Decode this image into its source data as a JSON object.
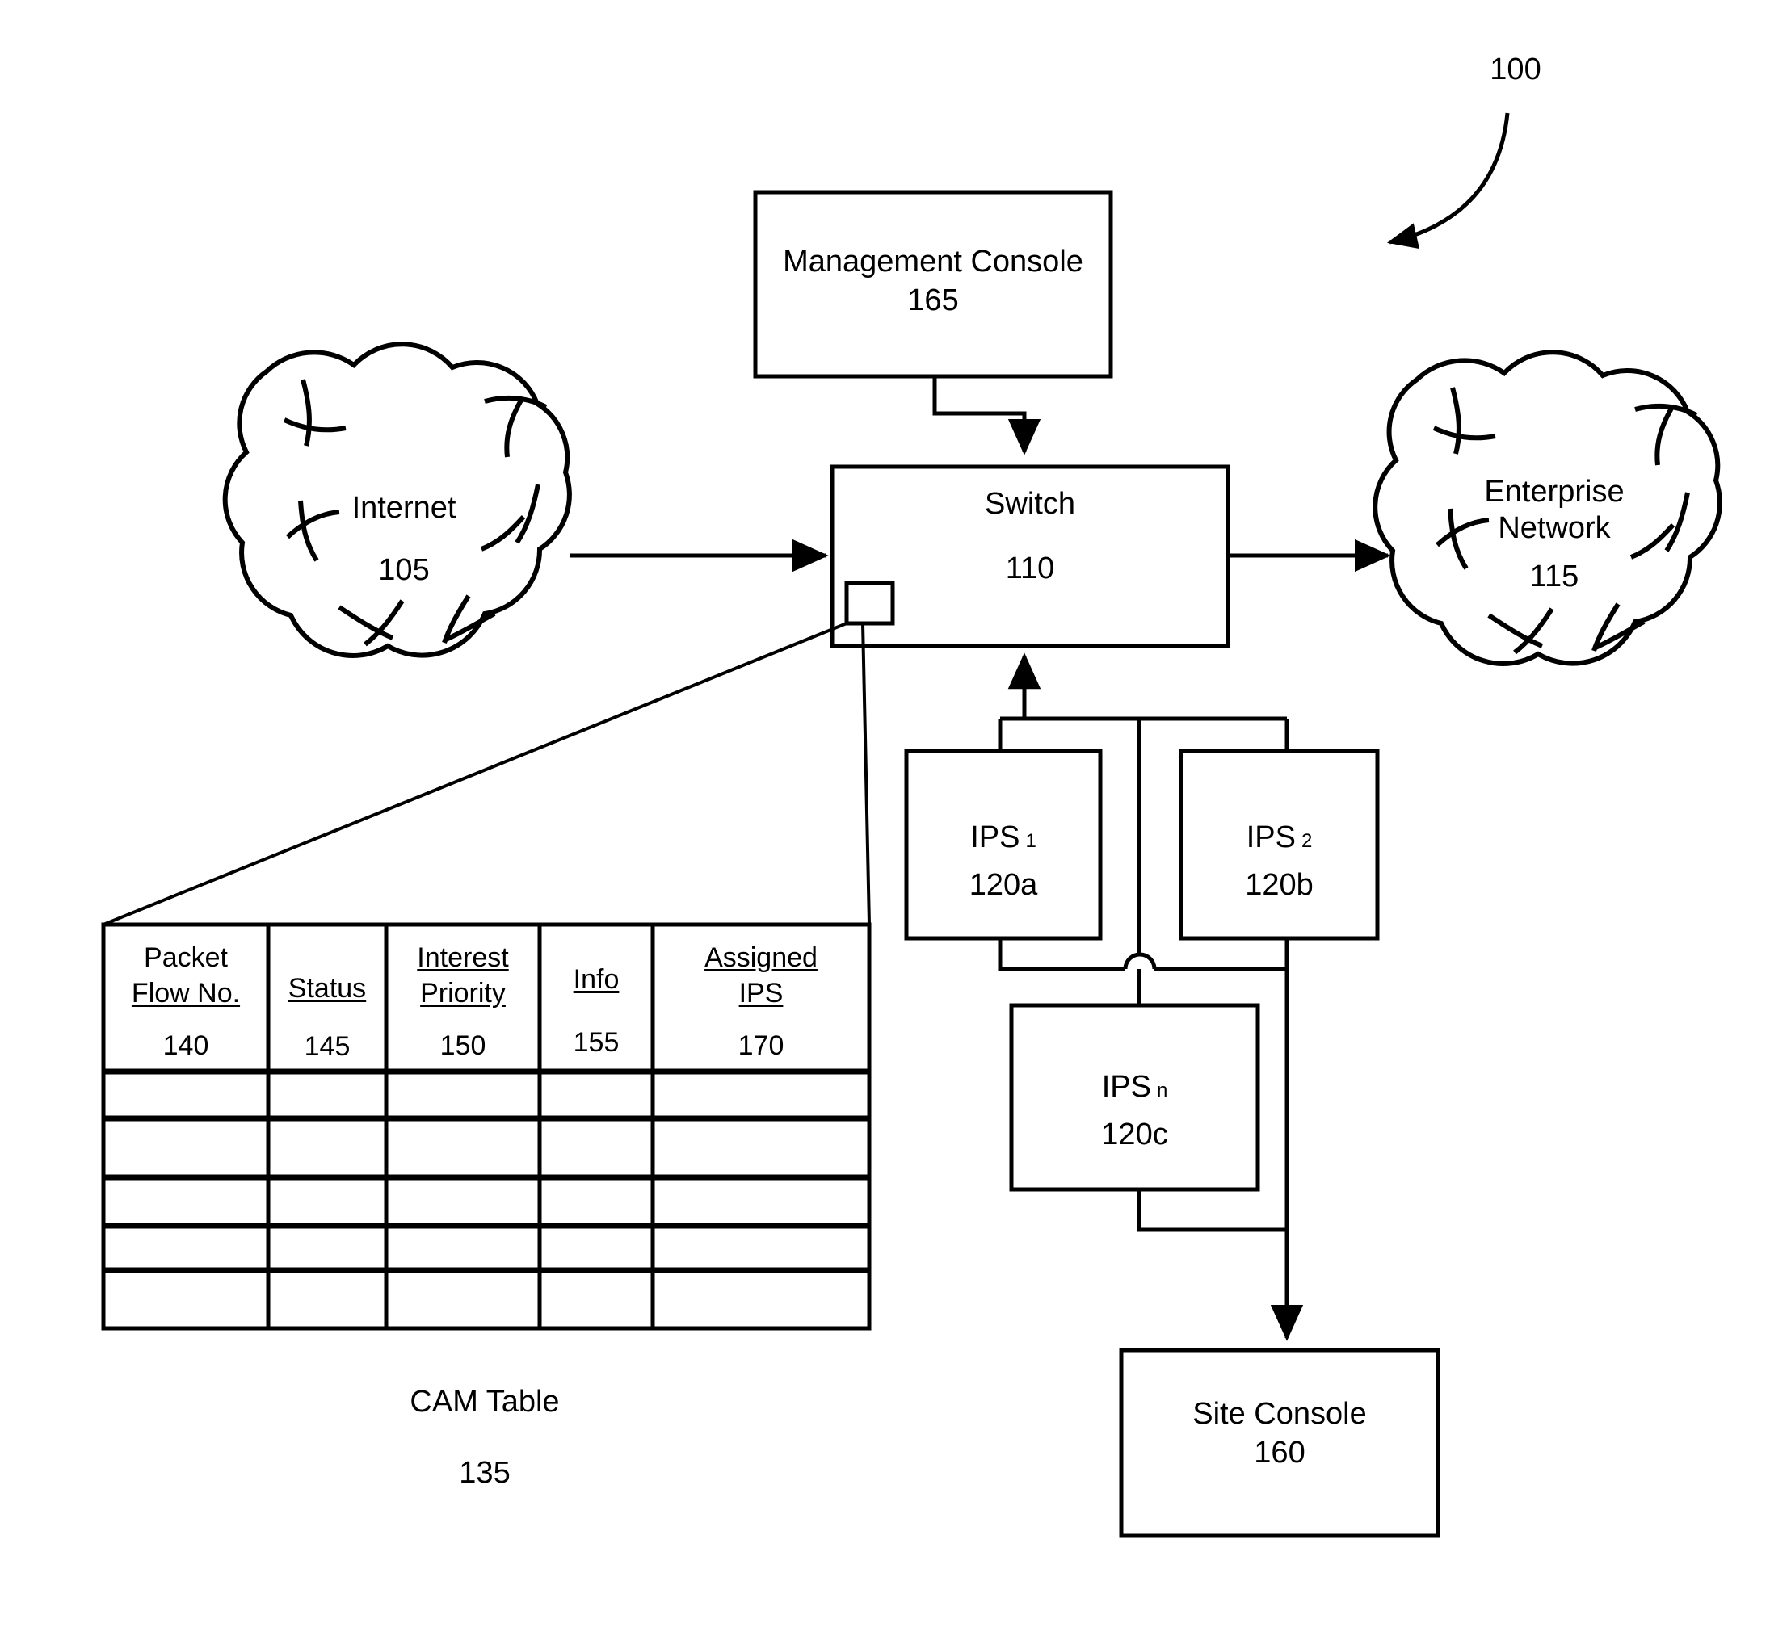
{
  "figure": {
    "reference_numeral": "100",
    "title_caption": "CAM Table",
    "title_caption_ref": "135"
  },
  "nodes": {
    "management_console": {
      "label": "Management Console",
      "ref": "165"
    },
    "internet": {
      "label": "Internet",
      "ref": "105"
    },
    "switch": {
      "label": "Switch",
      "ref": "110"
    },
    "enterprise_network": {
      "label": "Enterprise\nNetwork",
      "ref": "115"
    },
    "enterprise_line1": "Enterprise",
    "enterprise_line2": "Network",
    "ips1": {
      "label": "IPS",
      "subscript": "1",
      "ref": "120a"
    },
    "ips2": {
      "label": "IPS",
      "subscript": "2",
      "ref": "120b"
    },
    "ipsn": {
      "label": "IPS",
      "subscript": "n",
      "ref": "120c"
    },
    "site_console": {
      "label": "Site Console",
      "ref": "160"
    }
  },
  "cam_table": {
    "caption": "CAM Table",
    "caption_ref": "135",
    "columns": [
      {
        "header_line1": "Packet",
        "header_line2": "Flow No.",
        "ref": "140"
      },
      {
        "header_line1": "Status",
        "header_line2": "",
        "ref": "145"
      },
      {
        "header_line1": "Interest",
        "header_line2": "Priority",
        "ref": "150"
      },
      {
        "header_line1": "Info",
        "header_line2": "",
        "ref": "155"
      },
      {
        "header_line1": "Assigned",
        "header_line2": "IPS",
        "ref": "170"
      }
    ],
    "empty_row_count": 5,
    "rows": [
      [
        "",
        "",
        "",
        "",
        ""
      ],
      [
        "",
        "",
        "",
        "",
        ""
      ],
      [
        "",
        "",
        "",
        "",
        ""
      ],
      [
        "",
        "",
        "",
        "",
        ""
      ],
      [
        "",
        "",
        "",
        "",
        ""
      ]
    ]
  },
  "style": {
    "line_color": "#000000",
    "background": "#ffffff"
  }
}
